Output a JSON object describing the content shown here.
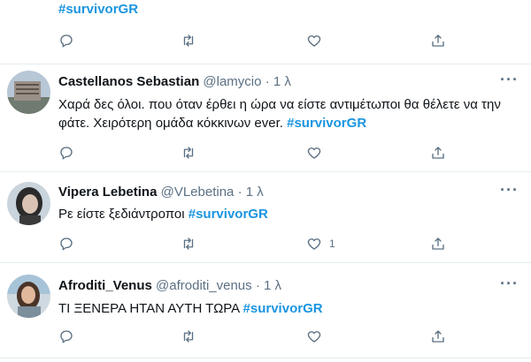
{
  "tweets": [
    {
      "name": "",
      "handle": "",
      "time": "",
      "text": "",
      "hashtag": "#survivorGR",
      "like_count": ""
    },
    {
      "name": "Castellanos Sebastian",
      "handle": "@lamycio",
      "separator": "·",
      "time": "1 λ",
      "text": "Χαρά δες όλοι. που όταν έρθει η ώρα να είστε αντιμέτωποι θα θέλετε να την φάτε. Χειρότερη ομάδα κόκκινων ever.",
      "hashtag": "#survivorGR",
      "like_count": ""
    },
    {
      "name": "Vipera Lebetina",
      "handle": "@VLebetina",
      "separator": "·",
      "time": "1 λ",
      "text": "Ρε είστε ξεδιάντροποι",
      "hashtag": "#survivorGR",
      "like_count": "1"
    },
    {
      "name": "Afroditi_Venus",
      "handle": "@afroditi_venus",
      "separator": "·",
      "time": "1 λ",
      "text": "ΤΙ ΞΕΝΕΡΑ ΗΤΑΝ ΑΥΤΗ ΤΩΡΑ",
      "hashtag": "#survivorGR",
      "like_count": ""
    }
  ],
  "more_label": "···",
  "icons": [
    "reply-icon",
    "retweet-icon",
    "like-icon",
    "share-icon"
  ],
  "colors": {
    "hashtag": "#1b95e0",
    "muted": "#5b7083",
    "divider": "#e6ecf0"
  }
}
